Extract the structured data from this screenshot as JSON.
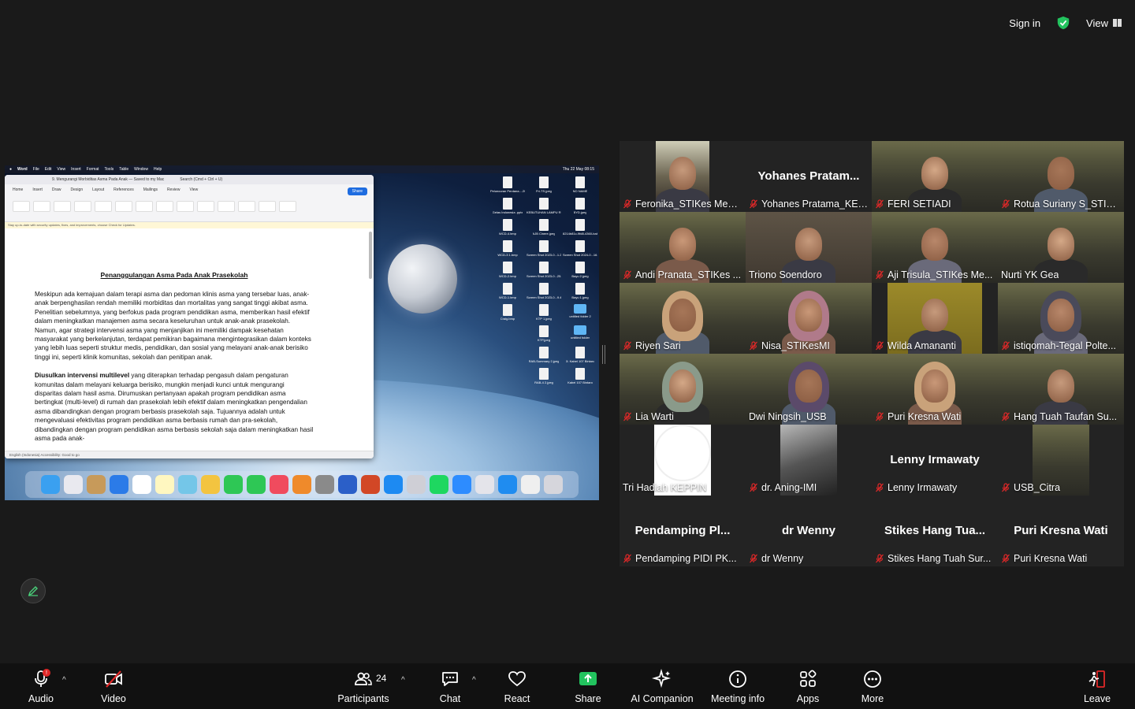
{
  "topbar": {
    "sign_in": "Sign in",
    "view": "View"
  },
  "shared_screen": {
    "mac_menu": [
      "Word",
      "File",
      "Edit",
      "View",
      "Insert",
      "Format",
      "Tools",
      "Table",
      "Window",
      "Help"
    ],
    "mac_time": "Thu 22 May 08:15",
    "word": {
      "doc_title": "9. Mengurangi Morbiditas Asma Pada Anak — Saved to my Mac",
      "search": "Search (Cmd + Ctrl + U)",
      "share": "Share",
      "tabs": [
        "Home",
        "Insert",
        "Draw",
        "Design",
        "Layout",
        "References",
        "Mailings",
        "Review",
        "View"
      ],
      "notice": "Stay up-to-date with security updates, fixes, and improvements, choose Check for Updates.",
      "heading": "Penanggulangan Asma Pada Anak Prasekolah",
      "para1": "Meskipun ada kemajuan dalam terapi asma dan pedoman klinis asma yang tersebar luas, anak-anak berpenghasilan rendah memiliki morbiditas dan mortalitas yang sangat tinggi akibat asma. Penelitian sebelumnya, yang berfokus pada program pendidikan asma, memberikan hasil efektif dalam meningkatkan manajemen asma secara keseluruhan untuk anak-anak prasekolah. Namun, agar strategi intervensi asma yang menjanjikan ini memiliki dampak kesehatan masyarakat yang berkelanjutan, terdapat pemikiran bagaimana mengintegrasikan dalam konteks yang lebih luas seperti struktur medis, pendidikan, dan sosial yang melayani anak-anak berisiko tinggi ini, seperti klinik komunitas, sekolah dan penitipan anak.",
      "para2_bold": "Diusulkan intervensi multilevel",
      "para2": " yang diterapkan terhadap pengasuh dalam pengaturan komunitas dalam melayani keluarga berisiko, mungkin menjadi kunci untuk mengurangi disparitas dalam hasil asma. Dirumuskan pertanyaan apakah program pendidikan asma bertingkat (multi-level) di rumah dan prasekolah lebih efektif dalam meningkatkan pengendalian asma dibandingkan dengan program berbasis prasekolah saja. Tujuannya adalah untuk mengevaluasi efektivitas program pendidikan asma berbasis rumah dan pra-sekolah, dibandingkan dengan program pendidikan asma berbasis sekolah saja dalam meningkatkan hasil asma pada anak-",
      "status": "English (Indonesia)   Accessibility: Good to go"
    },
    "desktop_icons": [
      "Peluncuran Perdana....2022.pdf",
      "Fri-TS.jpeg",
      "NO NAME",
      "Gelas Indonesia .pptx",
      "KEBUTUHAN LAMPU RUMAH IB",
      "BYD.jpeg",
      "WCD-4.bmp",
      "AJB Cinere.jpeg",
      "8214b81c-9fd8-4360-bab...9-3.JPG",
      "WCD-3 1.bmp",
      "Screen Shot 2023-0...1.23.15.25",
      "Screen Shot 2024-0...16.36.55",
      "WCD-2.bmp",
      "Screen Shot 2023-0...25.07.30",
      "Bayu 2.jpeg",
      "WCD-1.bmp",
      "Screen Shot 2023-0...9.47.10",
      "Bayu 1.jpeg",
      "Craig.bmp",
      "KTP 1.jpeg",
      "untitled folder 2",
      "",
      "KTP.jpeg",
      "untitled folder",
      "",
      "RAB-Summary 2.jpeg",
      "Jl. Kabel 107 Bintaro",
      "",
      "RAB-4 2.jpeg",
      "Kabel 107 Bintaro"
    ]
  },
  "participants": [
    {
      "name": "Feronika_STIKes Medi...",
      "video": true
    },
    {
      "name": "Yohanes Pratama_KEPPIN",
      "big": "Yohanes  Pratam...",
      "video": false
    },
    {
      "name": "FERI SETIADI",
      "video": true
    },
    {
      "name": "Rotua Suriany S_STIK...",
      "video": true
    },
    {
      "name": "Andi Pranata_STIKes ...",
      "video": true
    },
    {
      "name": "Triono Soendoro",
      "video": true,
      "active": true,
      "unmuted": true
    },
    {
      "name": "Aji Trisula_STIKes Me...",
      "video": true
    },
    {
      "name": "Nurti YK Gea",
      "video": true,
      "unmuted": true
    },
    {
      "name": "Riyen Sari",
      "video": true
    },
    {
      "name": "Nisa_STIKesMI",
      "video": true
    },
    {
      "name": "Wilda Amananti",
      "video": true
    },
    {
      "name": "istiqomah-Tegal Polte...",
      "video": true
    },
    {
      "name": "Lia Warti",
      "video": true
    },
    {
      "name": "Dwi Ningsih_USB",
      "video": true,
      "unmuted": true
    },
    {
      "name": "Puri Kresna Wati",
      "video": true
    },
    {
      "name": "Hang Tuah Taufan Su...",
      "video": true
    },
    {
      "name": "Tri Hadiah KEPPIN",
      "video": true,
      "unmuted": true
    },
    {
      "name": "dr. Aning-IMI",
      "video": true
    },
    {
      "name": "Lenny Irmawaty",
      "big": "Lenny Irmawaty",
      "video": false
    },
    {
      "name": "USB_Citra",
      "video": true
    },
    {
      "name": "Pendamping PIDI PK...",
      "big": "Pendamping  Pl...",
      "video": false
    },
    {
      "name": "dr Wenny",
      "big": "dr Wenny",
      "video": false
    },
    {
      "name": "Stikes Hang Tuah Sur...",
      "big": "Stikes  Hang  Tua...",
      "video": false
    },
    {
      "name": "Puri Kresna Wati",
      "big": "Puri Kresna Wati",
      "video": false
    }
  ],
  "toolbar": {
    "audio": "Audio",
    "audio_badge": "!",
    "video": "Video",
    "participants": "Participants",
    "participants_count": "24",
    "chat": "Chat",
    "react": "React",
    "share": "Share",
    "ai": "AI Companion",
    "info": "Meeting info",
    "apps": "Apps",
    "more": "More",
    "leave": "Leave"
  },
  "colors": {
    "share_green": "#22c35e",
    "muted_red": "#e02828",
    "active_border": "#22c35e"
  }
}
